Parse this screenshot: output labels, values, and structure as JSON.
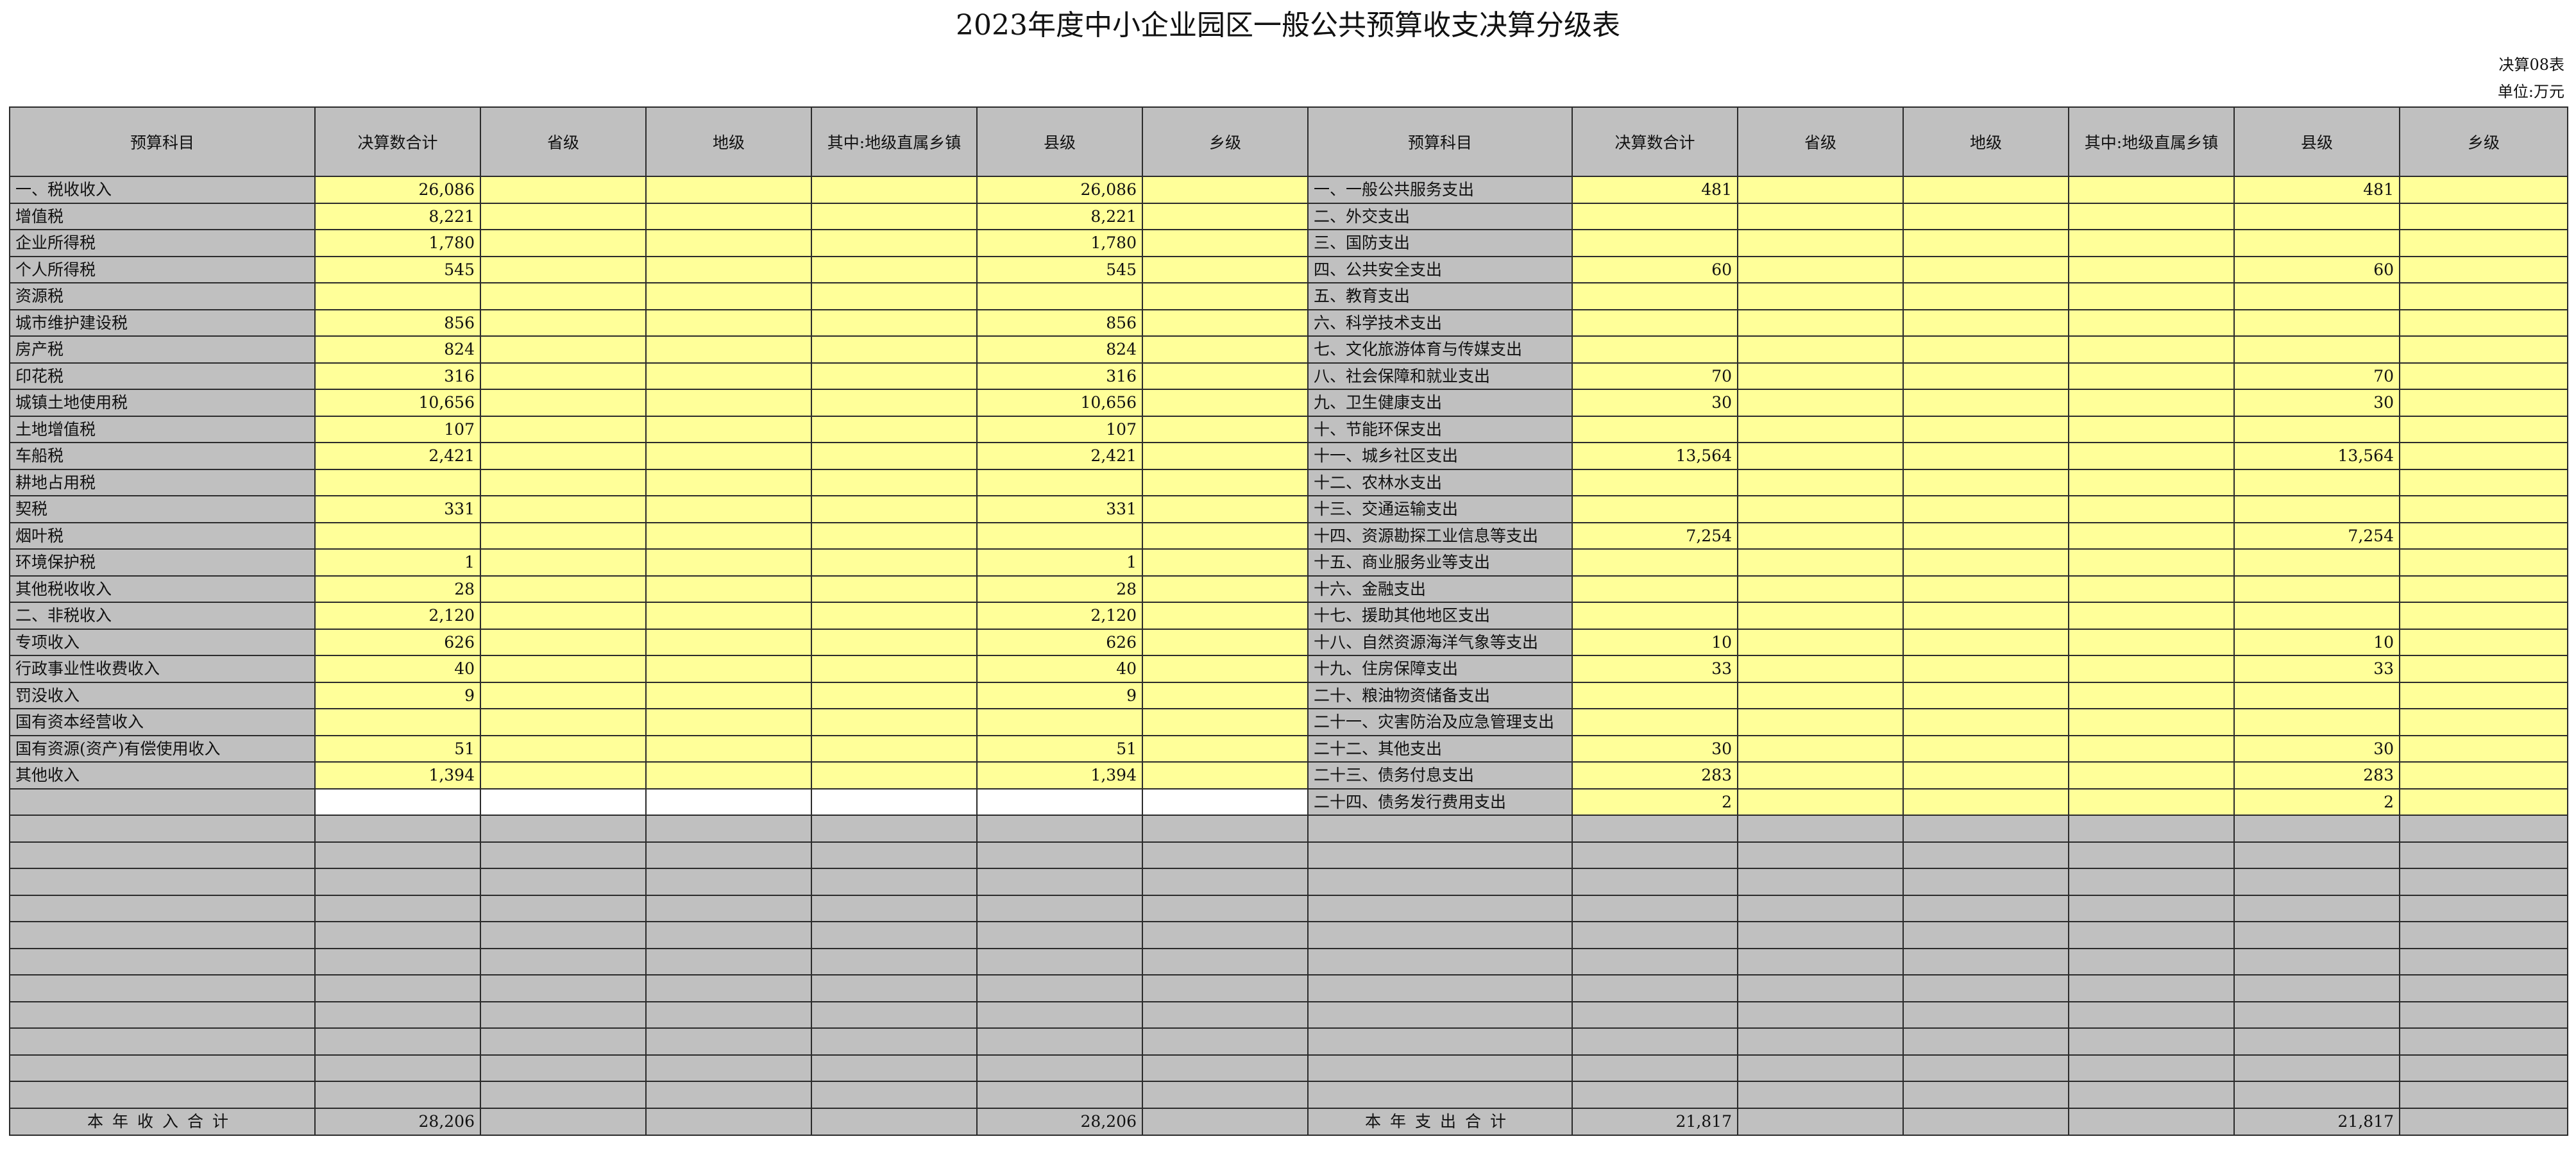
{
  "title": "2023年度中小企业园区一般公共预算收支决算分级表",
  "form_no": "决算08表",
  "unit": "单位:万元",
  "columns": [
    "预算科目",
    "决算数合计",
    "省级",
    "地级",
    "其中:地级直属乡镇",
    "县级",
    "乡级",
    "预算科目",
    "决算数合计",
    "省级",
    "地级",
    "其中:地级直属乡镇",
    "县级",
    "乡级"
  ],
  "rows": [
    {
      "l": {
        "name": "一、税收收入",
        "indent": false,
        "total": "26,086",
        "prov": "",
        "pref": "",
        "pref_town": "",
        "county": "26,086",
        "town": ""
      },
      "r": {
        "name": "一、一般公共服务支出",
        "indent": false,
        "total": "481",
        "prov": "",
        "pref": "",
        "pref_town": "",
        "county": "481",
        "town": ""
      }
    },
    {
      "l": {
        "name": "增值税",
        "indent": true,
        "total": "8,221",
        "prov": "",
        "pref": "",
        "pref_town": "",
        "county": "8,221",
        "town": ""
      },
      "r": {
        "name": "二、外交支出",
        "indent": false,
        "total": "",
        "prov": "",
        "pref": "",
        "pref_town": "",
        "county": "",
        "town": ""
      }
    },
    {
      "l": {
        "name": "企业所得税",
        "indent": true,
        "total": "1,780",
        "prov": "",
        "pref": "",
        "pref_town": "",
        "county": "1,780",
        "town": ""
      },
      "r": {
        "name": "三、国防支出",
        "indent": false,
        "total": "",
        "prov": "",
        "pref": "",
        "pref_town": "",
        "county": "",
        "town": ""
      }
    },
    {
      "l": {
        "name": "个人所得税",
        "indent": true,
        "total": "545",
        "prov": "",
        "pref": "",
        "pref_town": "",
        "county": "545",
        "town": ""
      },
      "r": {
        "name": "四、公共安全支出",
        "indent": false,
        "total": "60",
        "prov": "",
        "pref": "",
        "pref_town": "",
        "county": "60",
        "town": ""
      }
    },
    {
      "l": {
        "name": "资源税",
        "indent": true,
        "total": "",
        "prov": "",
        "pref": "",
        "pref_town": "",
        "county": "",
        "town": ""
      },
      "r": {
        "name": "五、教育支出",
        "indent": false,
        "total": "",
        "prov": "",
        "pref": "",
        "pref_town": "",
        "county": "",
        "town": ""
      }
    },
    {
      "l": {
        "name": "城市维护建设税",
        "indent": true,
        "total": "856",
        "prov": "",
        "pref": "",
        "pref_town": "",
        "county": "856",
        "town": ""
      },
      "r": {
        "name": "六、科学技术支出",
        "indent": false,
        "total": "",
        "prov": "",
        "pref": "",
        "pref_town": "",
        "county": "",
        "town": ""
      }
    },
    {
      "l": {
        "name": "房产税",
        "indent": true,
        "total": "824",
        "prov": "",
        "pref": "",
        "pref_town": "",
        "county": "824",
        "town": ""
      },
      "r": {
        "name": "七、文化旅游体育与传媒支出",
        "indent": false,
        "total": "",
        "prov": "",
        "pref": "",
        "pref_town": "",
        "county": "",
        "town": ""
      }
    },
    {
      "l": {
        "name": "印花税",
        "indent": true,
        "total": "316",
        "prov": "",
        "pref": "",
        "pref_town": "",
        "county": "316",
        "town": ""
      },
      "r": {
        "name": "八、社会保障和就业支出",
        "indent": false,
        "total": "70",
        "prov": "",
        "pref": "",
        "pref_town": "",
        "county": "70",
        "town": ""
      }
    },
    {
      "l": {
        "name": "城镇土地使用税",
        "indent": true,
        "total": "10,656",
        "prov": "",
        "pref": "",
        "pref_town": "",
        "county": "10,656",
        "town": ""
      },
      "r": {
        "name": "九、卫生健康支出",
        "indent": false,
        "total": "30",
        "prov": "",
        "pref": "",
        "pref_town": "",
        "county": "30",
        "town": ""
      }
    },
    {
      "l": {
        "name": "土地增值税",
        "indent": true,
        "total": "107",
        "prov": "",
        "pref": "",
        "pref_town": "",
        "county": "107",
        "town": ""
      },
      "r": {
        "name": "十、节能环保支出",
        "indent": false,
        "total": "",
        "prov": "",
        "pref": "",
        "pref_town": "",
        "county": "",
        "town": ""
      }
    },
    {
      "l": {
        "name": "车船税",
        "indent": true,
        "total": "2,421",
        "prov": "",
        "pref": "",
        "pref_town": "",
        "county": "2,421",
        "town": ""
      },
      "r": {
        "name": "十一、城乡社区支出",
        "indent": false,
        "total": "13,564",
        "prov": "",
        "pref": "",
        "pref_town": "",
        "county": "13,564",
        "town": ""
      }
    },
    {
      "l": {
        "name": "耕地占用税",
        "indent": true,
        "total": "",
        "prov": "",
        "pref": "",
        "pref_town": "",
        "county": "",
        "town": ""
      },
      "r": {
        "name": "十二、农林水支出",
        "indent": false,
        "total": "",
        "prov": "",
        "pref": "",
        "pref_town": "",
        "county": "",
        "town": ""
      }
    },
    {
      "l": {
        "name": "契税",
        "indent": true,
        "total": "331",
        "prov": "",
        "pref": "",
        "pref_town": "",
        "county": "331",
        "town": ""
      },
      "r": {
        "name": "十三、交通运输支出",
        "indent": false,
        "total": "",
        "prov": "",
        "pref": "",
        "pref_town": "",
        "county": "",
        "town": ""
      }
    },
    {
      "l": {
        "name": "烟叶税",
        "indent": true,
        "total": "",
        "prov": "",
        "pref": "",
        "pref_town": "",
        "county": "",
        "town": ""
      },
      "r": {
        "name": "十四、资源勘探工业信息等支出",
        "indent": false,
        "total": "7,254",
        "prov": "",
        "pref": "",
        "pref_town": "",
        "county": "7,254",
        "town": ""
      }
    },
    {
      "l": {
        "name": "环境保护税",
        "indent": true,
        "total": "1",
        "prov": "",
        "pref": "",
        "pref_town": "",
        "county": "1",
        "town": ""
      },
      "r": {
        "name": "十五、商业服务业等支出",
        "indent": false,
        "total": "",
        "prov": "",
        "pref": "",
        "pref_town": "",
        "county": "",
        "town": ""
      }
    },
    {
      "l": {
        "name": "其他税收收入",
        "indent": true,
        "total": "28",
        "prov": "",
        "pref": "",
        "pref_town": "",
        "county": "28",
        "town": ""
      },
      "r": {
        "name": "十六、金融支出",
        "indent": false,
        "total": "",
        "prov": "",
        "pref": "",
        "pref_town": "",
        "county": "",
        "town": ""
      }
    },
    {
      "l": {
        "name": "二、非税收入",
        "indent": false,
        "total": "2,120",
        "prov": "",
        "pref": "",
        "pref_town": "",
        "county": "2,120",
        "town": ""
      },
      "r": {
        "name": "十七、援助其他地区支出",
        "indent": false,
        "total": "",
        "prov": "",
        "pref": "",
        "pref_town": "",
        "county": "",
        "town": ""
      }
    },
    {
      "l": {
        "name": "专项收入",
        "indent": true,
        "total": "626",
        "prov": "",
        "pref": "",
        "pref_town": "",
        "county": "626",
        "town": ""
      },
      "r": {
        "name": "十八、自然资源海洋气象等支出",
        "indent": false,
        "total": "10",
        "prov": "",
        "pref": "",
        "pref_town": "",
        "county": "10",
        "town": ""
      }
    },
    {
      "l": {
        "name": "行政事业性收费收入",
        "indent": true,
        "total": "40",
        "prov": "",
        "pref": "",
        "pref_town": "",
        "county": "40",
        "town": ""
      },
      "r": {
        "name": "十九、住房保障支出",
        "indent": false,
        "total": "33",
        "prov": "",
        "pref": "",
        "pref_town": "",
        "county": "33",
        "town": ""
      }
    },
    {
      "l": {
        "name": "罚没收入",
        "indent": true,
        "total": "9",
        "prov": "",
        "pref": "",
        "pref_town": "",
        "county": "9",
        "town": ""
      },
      "r": {
        "name": "二十、粮油物资储备支出",
        "indent": false,
        "total": "",
        "prov": "",
        "pref": "",
        "pref_town": "",
        "county": "",
        "town": ""
      }
    },
    {
      "l": {
        "name": "国有资本经营收入",
        "indent": true,
        "total": "",
        "prov": "",
        "pref": "",
        "pref_town": "",
        "county": "",
        "town": ""
      },
      "r": {
        "name": "二十一、灾害防治及应急管理支出",
        "indent": false,
        "total": "",
        "prov": "",
        "pref": "",
        "pref_town": "",
        "county": "",
        "town": ""
      }
    },
    {
      "l": {
        "name": "国有资源(资产)有偿使用收入",
        "indent": true,
        "total": "51",
        "prov": "",
        "pref": "",
        "pref_town": "",
        "county": "51",
        "town": ""
      },
      "r": {
        "name": "二十二、其他支出",
        "indent": false,
        "total": "30",
        "prov": "",
        "pref": "",
        "pref_town": "",
        "county": "30",
        "town": ""
      }
    },
    {
      "l": {
        "name": "其他收入",
        "indent": true,
        "total": "1,394",
        "prov": "",
        "pref": "",
        "pref_town": "",
        "county": "1,394",
        "town": ""
      },
      "r": {
        "name": "二十三、债务付息支出",
        "indent": false,
        "total": "283",
        "prov": "",
        "pref": "",
        "pref_town": "",
        "county": "283",
        "town": ""
      }
    },
    {
      "l": null,
      "r": {
        "name": "二十四、债务发行费用支出",
        "indent": false,
        "total": "2",
        "prov": "",
        "pref": "",
        "pref_town": "",
        "county": "2",
        "town": ""
      }
    },
    {
      "l": null,
      "r": null
    },
    {
      "l": null,
      "r": null
    },
    {
      "l": null,
      "r": null
    },
    {
      "l": null,
      "r": null
    },
    {
      "l": null,
      "r": null
    },
    {
      "l": null,
      "r": null
    },
    {
      "l": null,
      "r": null
    },
    {
      "l": null,
      "r": null
    },
    {
      "l": null,
      "r": null
    },
    {
      "l": null,
      "r": null
    },
    {
      "l": null,
      "r": null
    }
  ],
  "totals": {
    "left_label": "本年收入合计",
    "left": {
      "total": "28,206",
      "prov": "",
      "pref": "",
      "pref_town": "",
      "county": "28,206",
      "town": ""
    },
    "right_label": "本年支出合计",
    "right": {
      "total": "21,817",
      "prov": "",
      "pref": "",
      "pref_town": "",
      "county": "21,817",
      "town": ""
    }
  }
}
